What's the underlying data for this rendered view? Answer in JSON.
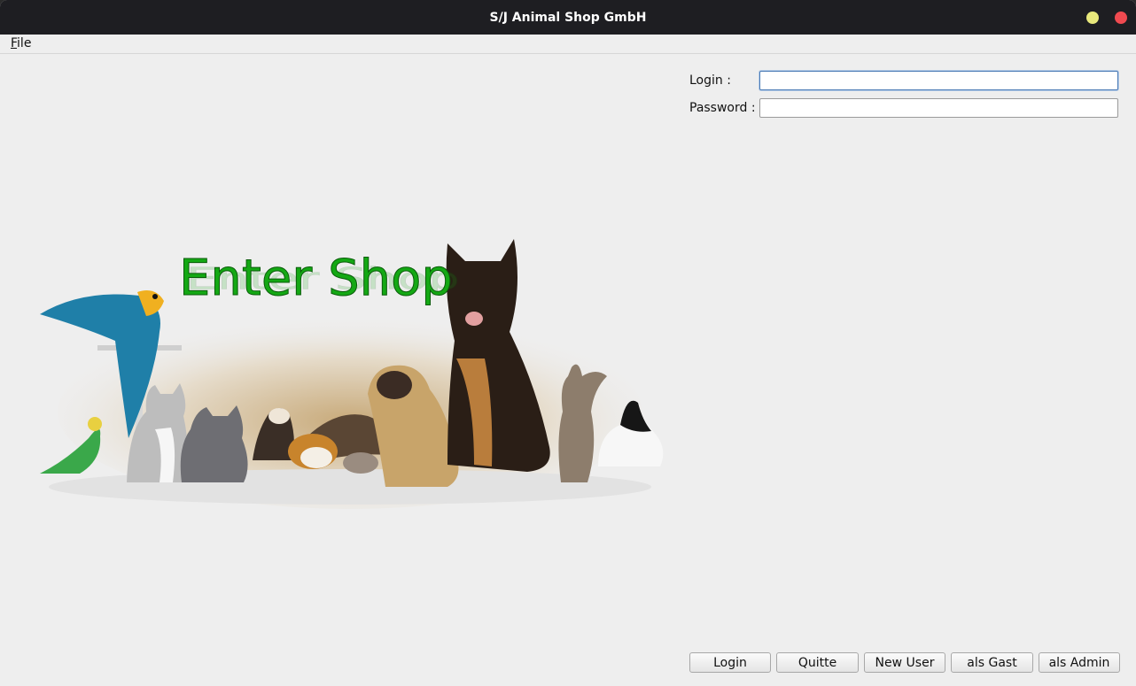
{
  "window": {
    "title": "S/J Animal Shop GmbH"
  },
  "menu": {
    "file_mnemonic": "F",
    "file_rest": "ile"
  },
  "form": {
    "login_label": "Login :",
    "login_value": "",
    "password_label": "Password :",
    "password_value": ""
  },
  "hero": {
    "caption": "Enter Shop"
  },
  "buttons": {
    "login": "Login",
    "quit": "Quitte",
    "new_user": "New User",
    "guest": "als Gast",
    "admin": "als Admin"
  },
  "colors": {
    "titlebar": "#1e1e22",
    "window_bg": "#eeeeee",
    "hero_text": "#14a814",
    "minimize": "#e8e87c",
    "close": "#f04a50"
  }
}
